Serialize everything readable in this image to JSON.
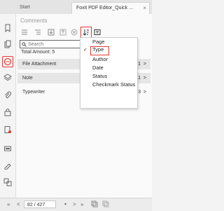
{
  "tabs": [
    {
      "label": "Start"
    },
    {
      "label": "Foxit PDF Editor_Quick ..."
    }
  ],
  "tab_close": "×",
  "panel": {
    "title": "Comments",
    "search_placeholder": "Search",
    "total": "Total Amount: 5"
  },
  "rows": [
    {
      "label": "File Attachment",
      "count": "1",
      "chevron": ">"
    },
    {
      "label": "Note",
      "count": "1",
      "chevron": ">"
    },
    {
      "label": "Typewriter",
      "count": "3",
      "chevron": ">"
    }
  ],
  "sort_menu": {
    "items": [
      "Page",
      "Type",
      "Author",
      "Date",
      "Status",
      "Checkmark Status"
    ],
    "selected": "Type",
    "check": "✓"
  },
  "bottom": {
    "first": "«",
    "prev": "<",
    "page": "82 / 427",
    "dropdown": "▾",
    "next": ">",
    "last": "»"
  },
  "colors": {
    "accent": "#e53935"
  }
}
